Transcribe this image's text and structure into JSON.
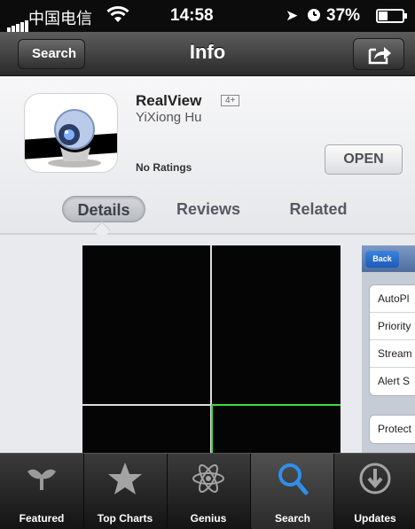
{
  "status_bar": {
    "carrier": "中国电信",
    "time": "14:58",
    "battery": "37%"
  },
  "nav": {
    "back_label": "Search",
    "title": "Info"
  },
  "app": {
    "name": "RealView",
    "age_rating": "4+",
    "developer": "YiXiong Hu",
    "ratings": "No Ratings",
    "open_label": "OPEN"
  },
  "segments": [
    {
      "label": "Details",
      "selected": true
    },
    {
      "label": "Reviews",
      "selected": false
    },
    {
      "label": "Related",
      "selected": false
    }
  ],
  "screenshot2": {
    "back_label": "Back",
    "rows_group1": [
      "AutoPl",
      "Priority",
      "Stream",
      "Alert S"
    ],
    "rows_group2": [
      "Protect"
    ]
  },
  "tab_bar": [
    {
      "label": "Featured",
      "icon": "featured-icon",
      "selected": false
    },
    {
      "label": "Top Charts",
      "icon": "star-icon",
      "selected": false
    },
    {
      "label": "Genius",
      "icon": "atom-icon",
      "selected": false
    },
    {
      "label": "Search",
      "icon": "search-icon",
      "selected": true
    },
    {
      "label": "Updates",
      "icon": "download-arrow-icon",
      "selected": false
    }
  ],
  "colors": {
    "green_grid": "#3ddc3d",
    "search_active": "#2f8fe8"
  }
}
